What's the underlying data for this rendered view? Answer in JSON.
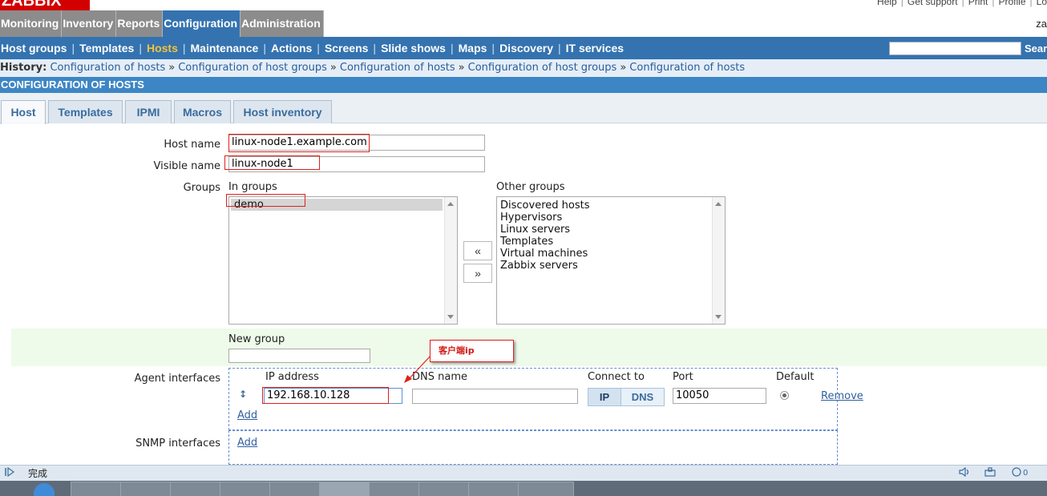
{
  "app": {
    "logo": "ZABBIX",
    "top_links": [
      "Help",
      "Get support",
      "Print",
      "Profile",
      "Lo"
    ],
    "user_text": "za"
  },
  "main_menu": [
    {
      "label": "Monitoring",
      "active": false
    },
    {
      "label": "Inventory",
      "active": false
    },
    {
      "label": "Reports",
      "active": false
    },
    {
      "label": "Configuration",
      "active": true
    },
    {
      "label": "Administration",
      "active": false
    }
  ],
  "sub_menu": [
    {
      "label": "Host groups",
      "active": false
    },
    {
      "label": "Templates",
      "active": false
    },
    {
      "label": "Hosts",
      "active": true
    },
    {
      "label": "Maintenance",
      "active": false
    },
    {
      "label": "Actions",
      "active": false
    },
    {
      "label": "Screens",
      "active": false
    },
    {
      "label": "Slide shows",
      "active": false
    },
    {
      "label": "Maps",
      "active": false
    },
    {
      "label": "Discovery",
      "active": false
    },
    {
      "label": "IT services",
      "active": false
    }
  ],
  "search": {
    "button_label": "Sear",
    "value": ""
  },
  "history": {
    "label": "History:",
    "items": [
      "Configuration of hosts",
      "Configuration of host groups",
      "Configuration of hosts",
      "Configuration of host groups",
      "Configuration of hosts"
    ],
    "separator": "»"
  },
  "page_title": "CONFIGURATION OF HOSTS",
  "tabs": [
    {
      "label": "Host",
      "active": true
    },
    {
      "label": "Templates",
      "active": false
    },
    {
      "label": "IPMI",
      "active": false
    },
    {
      "label": "Macros",
      "active": false
    },
    {
      "label": "Host inventory",
      "active": false
    }
  ],
  "form": {
    "host_name_label": "Host name",
    "host_name_value": "linux-node1.example.com",
    "visible_name_label": "Visible name",
    "visible_name_value": "linux-node1",
    "groups_label": "Groups",
    "in_groups_label": "In groups",
    "in_groups": [
      "demo"
    ],
    "other_groups_label": "Other groups",
    "other_groups": [
      "Discovered hosts",
      "Hypervisors",
      "Linux servers",
      "Templates",
      "Virtual machines",
      "Zabbix servers"
    ],
    "move_left_label": "«",
    "move_right_label": "»",
    "new_group_label": "New group",
    "new_group_value": "",
    "agent_interfaces_label": "Agent interfaces",
    "snmp_interfaces_label": "SNMP interfaces",
    "interface_columns": {
      "ip": "IP address",
      "dns": "DNS name",
      "connect_to": "Connect to",
      "port": "Port",
      "default": "Default"
    },
    "agent_interface": {
      "ip": "192.168.10.128",
      "dns": "",
      "connect_options": [
        "IP",
        "DNS"
      ],
      "connect_selected": "IP",
      "port": "10050",
      "remove_label": "Remove"
    },
    "add_label": "Add",
    "snmp_add_label": "Add"
  },
  "annotation": {
    "callout_text": "客户端ip",
    "color": "#e0201a"
  },
  "status_bar": {
    "text": "完成"
  },
  "colors": {
    "menu_gray": "#8c8c8c",
    "menu_active": "#3473b0",
    "submenu_bg": "#3473b0",
    "submenu_active": "#f3c23c",
    "title_bar": "#3d86c5",
    "link": "#2f5fa0"
  }
}
